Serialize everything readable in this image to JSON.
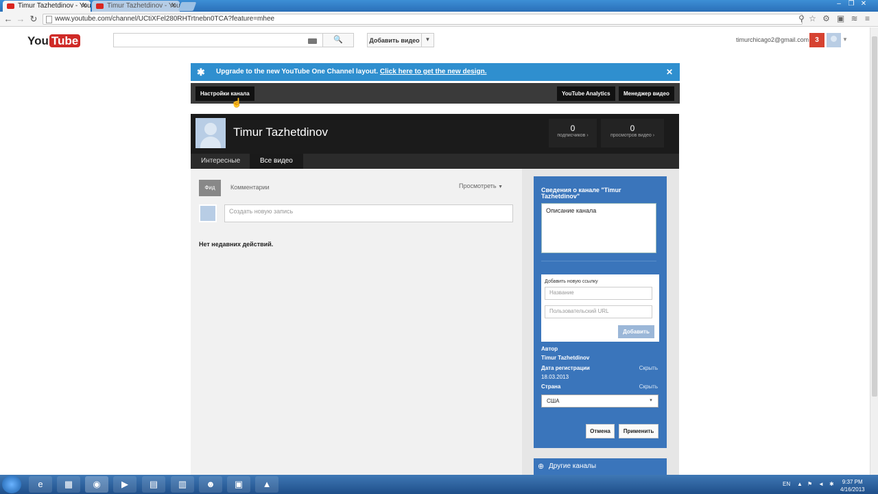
{
  "browser": {
    "tabs": [
      {
        "title": "Timur Tazhetdinov - YouT",
        "active": true
      },
      {
        "title": "Timur Tazhetdinov - You",
        "active": false
      }
    ],
    "url": "www.youtube.com/channel/UCtiXFel280RHTrtnebn0TCA?feature=mhee",
    "window_controls": [
      "–",
      "❐",
      "✕"
    ]
  },
  "header": {
    "logo_you": "You",
    "logo_tube": "Tube",
    "upload_label": "Добавить видео",
    "user_email": "timurchicago2@gmail.com",
    "notifications_count": "3"
  },
  "banner": {
    "text": "Upgrade to the new YouTube One Channel layout. ",
    "link_text": "Click here to get the new design."
  },
  "toolbar": {
    "settings_label": "Настройки канала",
    "analytics_label": "YouTube Analytics",
    "manager_label": "Менеджер видео"
  },
  "channel": {
    "name": "Timur Tazhetdinov",
    "subscribers_count": "0",
    "subscribers_label": "подписчиков ›",
    "views_count": "0",
    "views_label": "просмотров видео ›",
    "tabs": [
      "Интересные",
      "Все видео"
    ]
  },
  "feed": {
    "feed_label": "Фид",
    "comments_label": "Комментарии",
    "view_label": "Просмотреть",
    "post_placeholder": "Создать новую запись",
    "empty_text": "Нет недавних действий."
  },
  "info_panel": {
    "title": "Сведения о канале \"Timur Tazhetdinov\"",
    "description": "Описание канала",
    "link_section_title": "Добавить новую ссылку",
    "link_name_placeholder": "Название",
    "link_url_placeholder": "Пользовательский URL",
    "add_label": "Добавить",
    "author_label": "Автор",
    "author_value": "Timur Tazhetdinov",
    "reg_date_label": "Дата регистрации",
    "reg_date_value": "18.03.2013",
    "hide_label": "Скрыть",
    "country_label": "Страна",
    "country_value": "США",
    "cancel_label": "Отмена",
    "apply_label": "Применить",
    "other_channels_label": "Другие каналы"
  },
  "taskbar": {
    "language": "EN",
    "time": "9:37 PM",
    "date": "4/16/2013"
  }
}
